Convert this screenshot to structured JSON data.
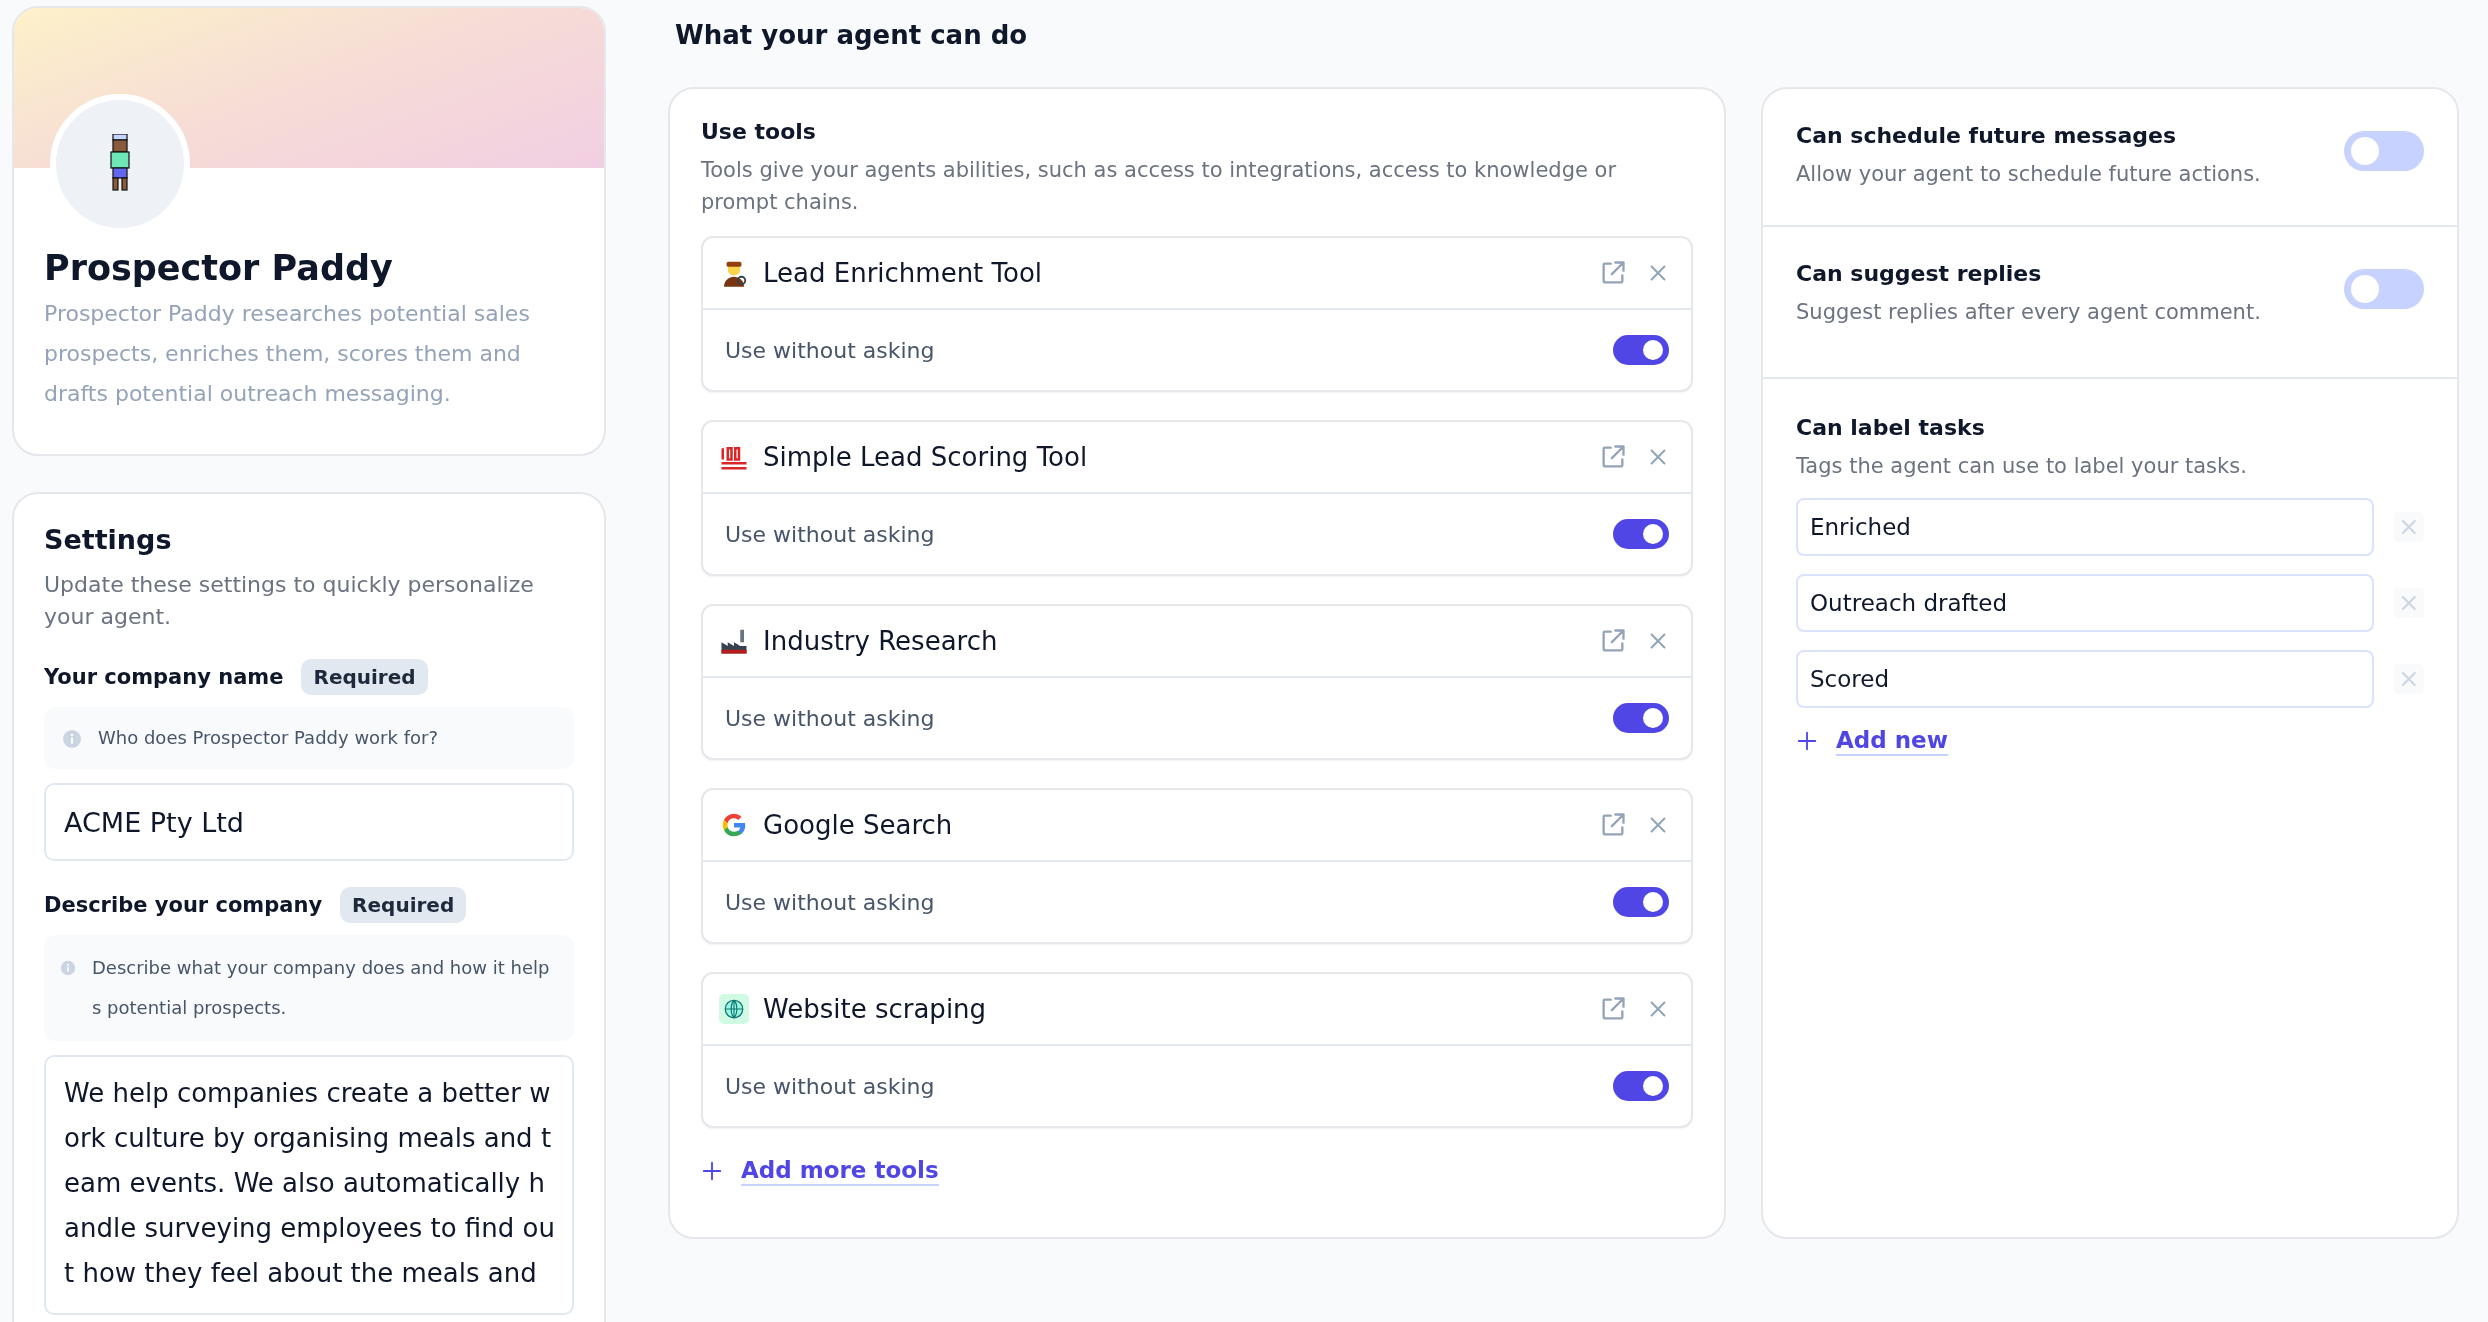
{
  "agent": {
    "name": "Prospector Paddy",
    "description": "Prospector Paddy researches potential sales prospects, enriches them, scores them and drafts potential outreach messaging."
  },
  "settings": {
    "title": "Settings",
    "description": "Update these settings to quickly personalize your agent.",
    "fields": [
      {
        "kind": "input",
        "label": "Your company name",
        "badge": "Required",
        "hint": "Who does Prospector Paddy work for?",
        "value": "ACME Pty Ltd"
      },
      {
        "kind": "textarea",
        "label": "Describe your company",
        "badge": "Required",
        "hint": "Describe what your company does and how it helps potential prospects.",
        "value": "We help companies create a better work culture by organising meals and team events. We also automatically handle surveying employees to find out how they feel about the meals and"
      }
    ]
  },
  "capabilities": {
    "title": "What your agent can do",
    "tools": {
      "title": "Use tools",
      "description": "Tools give your agents abilities, such as access to integrations, access to knowledge or prompt chains.",
      "items": [
        {
          "kind": "person",
          "name": "Lead Enrichment Tool",
          "option": "Use without asking",
          "on": true
        },
        {
          "kind": "hundred",
          "name": "Simple Lead Scoring Tool",
          "option": "Use without asking",
          "on": true
        },
        {
          "kind": "factory",
          "name": "Industry Research",
          "option": "Use without asking",
          "on": true
        },
        {
          "kind": "google",
          "name": "Google Search",
          "option": "Use without asking",
          "on": true
        },
        {
          "kind": "globe",
          "name": "Website scraping",
          "option": "Use without asking",
          "on": true
        }
      ],
      "add_link": "Add more tools"
    },
    "options": [
      {
        "title": "Can schedule future messages",
        "description": "Allow your agent to schedule future actions.",
        "on": false
      },
      {
        "title": "Can suggest replies",
        "description": "Suggest replies after every agent comment.",
        "on": false
      }
    ],
    "labels": {
      "title": "Can label tasks",
      "description": "Tags the agent can use to label your tasks.",
      "tags": [
        "Enriched",
        "Outreach drafted",
        "Scored"
      ],
      "add_link": "Add new"
    }
  }
}
